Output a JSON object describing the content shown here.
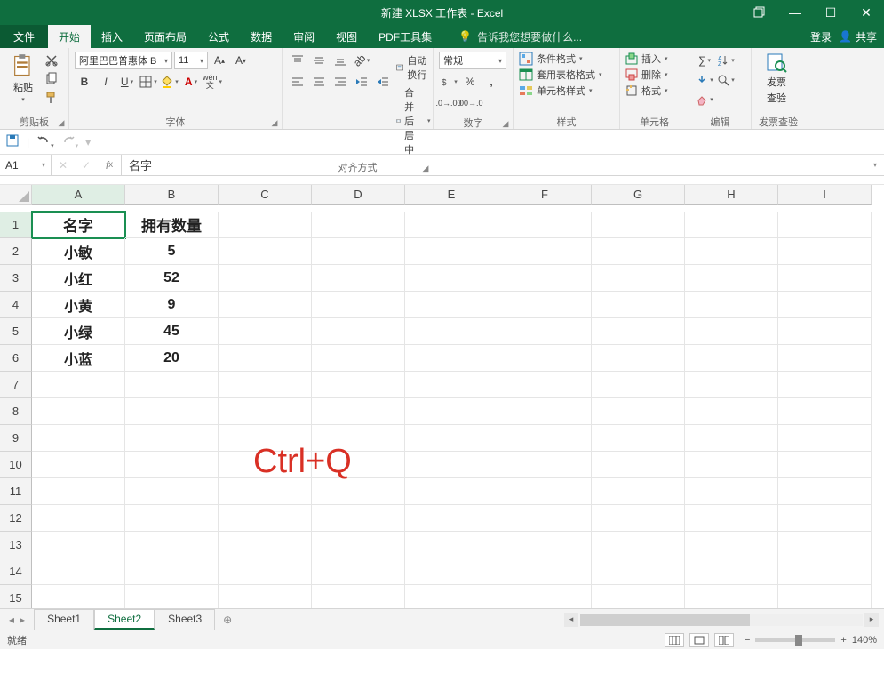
{
  "title": "新建 XLSX 工作表 - Excel",
  "menu": {
    "file": "文件",
    "tabs": [
      "开始",
      "插入",
      "页面布局",
      "公式",
      "数据",
      "审阅",
      "视图",
      "PDF工具集"
    ],
    "active": 0,
    "tellme": "告诉我您想要做什么...",
    "login": "登录",
    "share": "共享"
  },
  "ribbon": {
    "clipboard": {
      "label": "剪贴板",
      "paste": "粘贴"
    },
    "font": {
      "label": "字体",
      "name": "阿里巴巴普惠体 B",
      "size": "11",
      "ruby": "wén"
    },
    "align": {
      "label": "对齐方式",
      "wrap": "自动换行",
      "merge": "合并后居中"
    },
    "number": {
      "label": "数字",
      "format": "常规"
    },
    "styles": {
      "label": "样式",
      "cond": "条件格式",
      "tbl": "套用表格格式",
      "cell": "单元格样式"
    },
    "cells": {
      "label": "单元格",
      "ins": "插入",
      "del": "删除",
      "fmt": "格式"
    },
    "edit": {
      "label": "编辑"
    },
    "invoice": {
      "label": "发票查验",
      "title1": "发票",
      "title2": "查验"
    }
  },
  "namebox": "A1",
  "formula": "名字",
  "columns": [
    "A",
    "B",
    "C",
    "D",
    "E",
    "F",
    "G",
    "H",
    "I"
  ],
  "rows": [
    1,
    2,
    3,
    4,
    5,
    6,
    7,
    8,
    9,
    10,
    11,
    12,
    13,
    14,
    15
  ],
  "data": {
    "headers": [
      "名字",
      "拥有数量"
    ],
    "rows": [
      [
        "小敏",
        "5"
      ],
      [
        "小红",
        "52"
      ],
      [
        "小黄",
        "9"
      ],
      [
        "小绿",
        "45"
      ],
      [
        "小蓝",
        "20"
      ]
    ]
  },
  "overlay": "Ctrl+Q",
  "sheets": {
    "list": [
      "Sheet1",
      "Sheet2",
      "Sheet3"
    ],
    "active": 1
  },
  "status": {
    "ready": "就绪",
    "zoom": "140%"
  },
  "chart_data": {
    "type": "table",
    "categories": [
      "小敏",
      "小红",
      "小黄",
      "小绿",
      "小蓝"
    ],
    "values": [
      5,
      52,
      9,
      45,
      20
    ],
    "title": "拥有数量",
    "xlabel": "名字",
    "ylabel": "拥有数量"
  }
}
